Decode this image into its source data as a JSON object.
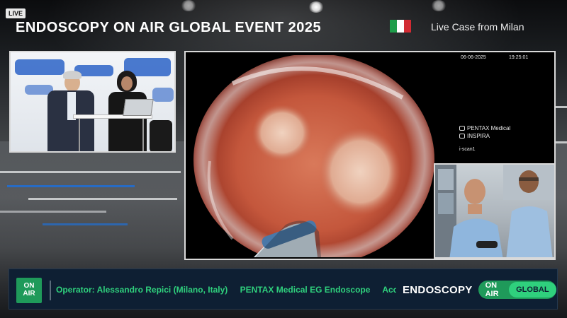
{
  "header": {
    "live_badge": "LIVE",
    "event_title": "ENDOSCOPY ON AIR GLOBAL EVENT 2025",
    "live_case": "Live Case from Milan",
    "flag_colors": [
      "#1e9d4a",
      "#ffffff",
      "#d22b33"
    ],
    "flag_icon": "italy-flag-icon"
  },
  "studio_panel": {
    "background_color": "#2c63c7"
  },
  "scope": {
    "date": "06-06-2025",
    "time": "19:25:01",
    "brand_line1": "PENTAX Medical",
    "brand_line2": "INSPIRA",
    "scan_mode": "i-scan1",
    "icons": [
      "camera-icon",
      "hospital-icon"
    ]
  },
  "lower_third": {
    "logo_line1": "ON",
    "logo_line2": "AIR",
    "ticker_items": [
      "Operator: Alessandro Repici (Milano, Italy)",
      "PENTAX Medical EG Endoscope",
      "Acces"
    ],
    "brand_endoscopy": "ENDOSCOPY",
    "brand_onair": "ON AIR",
    "brand_global": "GLOBAL",
    "accent_color": "#2fd07d",
    "dark_color": "#0e1f33"
  }
}
